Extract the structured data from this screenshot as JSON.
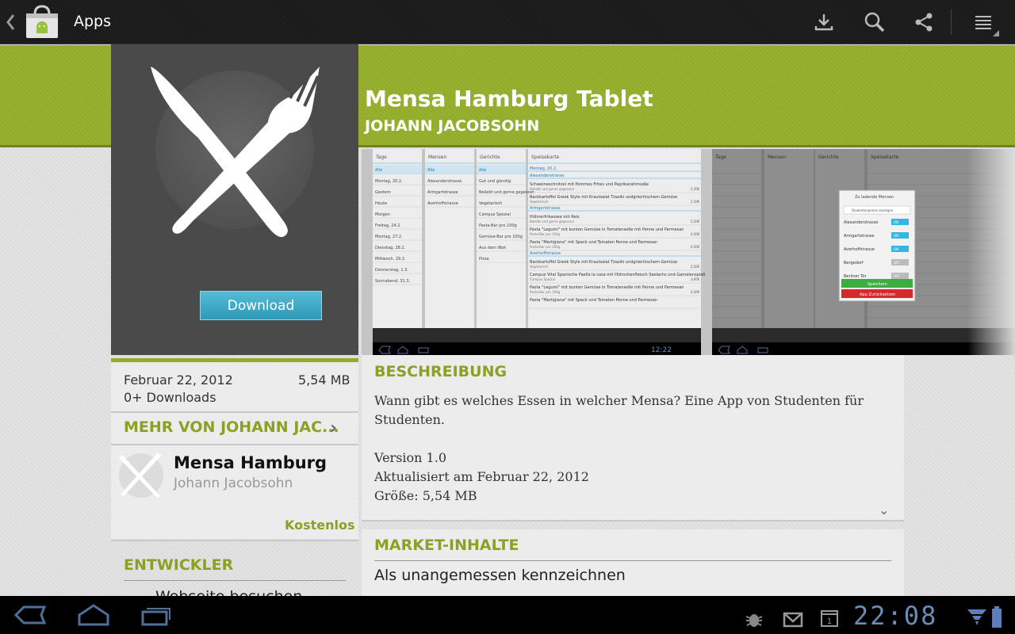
{
  "action_bar": {
    "title": "Apps",
    "icons": [
      "up-chevron-icon",
      "market-bag-icon",
      "download-icon",
      "search-icon",
      "share-icon",
      "overflow-menu-icon"
    ]
  },
  "app": {
    "title": "Mensa Hamburg Tablet",
    "developer": "JOHANN JACOBSOHN",
    "download_label": "Download",
    "icon": "cutlery-icon"
  },
  "meta": {
    "date": "Februar 22, 2012",
    "size": "5,54 MB",
    "downloads": "0+ Downloads"
  },
  "more_from": {
    "heading": "MEHR VON JOHANN JAC...",
    "item": {
      "title": "Mensa Hamburg",
      "developer": "Johann Jacobsohn",
      "price": "Kostenlos"
    }
  },
  "developer_section": {
    "heading": "ENTWICKLER",
    "website_label": "Webseite besuchen"
  },
  "description": {
    "heading": "BESCHREIBUNG",
    "lines": [
      "Wann gibt es welches Essen in welcher Mensa? Eine App von Studenten für",
      "Studenten.",
      "",
      "Version 1.0",
      "Aktualisiert am Februar 22, 2012",
      "Größe: 5,54 MB"
    ]
  },
  "market": {
    "heading": "MARKET-INHALTE",
    "report_label": "Als unangemessen kennzeichnen"
  },
  "screenshot1": {
    "col_headers": [
      "Tage",
      "Mensen",
      "Gerichte",
      "Speisekarte"
    ],
    "days": [
      "Alle",
      "Montag, 20.2.",
      "Gestern",
      "Heute",
      "Morgen",
      "Freitag, 24.2.",
      "Montag, 27.2.",
      "Dienstag, 28.2.",
      "Mittwoch, 29.2.",
      "Donnerstag, 1.3.",
      "Sonnabend, 31.3."
    ],
    "mensen": [
      "Alle",
      "Alexanderstrasse",
      "Armgartstrasse",
      "Averhoffstrasse"
    ],
    "gerichte": [
      "Alle",
      "Gut und günstig",
      "Beliebt und gerne gegessen",
      "Vegetarisch",
      "Campus Spezial",
      "Pasta-Bar pro 100g",
      "Gemüse-Bar pro 100g",
      "Aus dem Wok",
      "Pizza"
    ],
    "menu": [
      {
        "type": "header",
        "text": "Montag, 20.2."
      },
      {
        "type": "header",
        "text": "Alexanderstrasse"
      },
      {
        "type": "item",
        "text": "Schweineschnitzel mit Pommes Frites und Paprikarahmsoße",
        "sub": "Beliebt und gerne gegessen",
        "price": "2,20€"
      },
      {
        "type": "item",
        "text": "Backkartoffel Greek Style mit Krautsalat Tzaziki undgriechischem Gemüse",
        "sub": "Vegetarisch",
        "price": "2,50€"
      },
      {
        "type": "header",
        "text": "Armgartstrasse"
      },
      {
        "type": "item",
        "text": "Hühnerfrikassee mit Reis",
        "sub": "Beliebt und gerne gegessen",
        "price": "2,50€"
      },
      {
        "type": "item",
        "text": "Pasta \"Legumi\" mit bunten Gemüse in Tomatensoße mit Penne und Parmesan",
        "sub": "Pasta-Bar pro 100g",
        "price": "0,50€"
      },
      {
        "type": "item",
        "text": "Pasta \"Martigiana\" mit Speck und Tomaten Penne und Parmesan",
        "sub": "Pasta-Bar pro 100g",
        "price": "0,50€"
      },
      {
        "type": "header",
        "text": "Averhoffstrasse"
      },
      {
        "type": "item",
        "text": "Backkartoffel Greek Style mit Krautsalat Tzaziki undgriechischem Gemüse",
        "sub": "Vegetarisch",
        "price": "2,50€"
      },
      {
        "type": "item",
        "text": "Campus Vital Spanische Paella la casa mit Hühnchenfleisch Seelachs und Garnelenspieß",
        "sub": "Campus Spezial",
        "price": "3,95€"
      },
      {
        "type": "item",
        "text": "Pasta \"Legumi\" mit bunten Gemüse in Tomatensoße mit Penne und Parmesan",
        "sub": "Pasta-Bar pro 100g",
        "price": "0,50€"
      },
      {
        "type": "item",
        "text": "Pasta \"Martigiana\" mit Speck und Tomaten Penne und Parmesan",
        "sub": "",
        "price": ""
      }
    ],
    "clock": "12:22"
  },
  "screenshot2": {
    "col_headers": [
      "Tage",
      "Mensen",
      "Gerichte",
      "Speisekarte"
    ],
    "dialog": {
      "title": "Zu ladende Mensen",
      "field": "Studentenpreise anzeigen",
      "toggles": [
        {
          "label": "Alexanderstrasse",
          "state": "ON"
        },
        {
          "label": "Armgartstrasse",
          "state": "ON"
        },
        {
          "label": "Averhoffstrasse",
          "state": "ON"
        },
        {
          "label": "Bergedorf",
          "state": "OFF"
        },
        {
          "label": "Berliner Tor",
          "state": "OFF"
        }
      ],
      "save_label": "Speichern",
      "reset_label": "App Zurücksetzen"
    }
  },
  "system_bar": {
    "clock": "22:08",
    "icons": [
      "back-icon",
      "home-icon",
      "recent-apps-icon",
      "debug-icon",
      "gmail-icon",
      "calendar-icon",
      "wifi-icon",
      "battery-icon"
    ],
    "calendar_day": "1"
  },
  "colors": {
    "accent_green": "#93ac2a",
    "section_green": "#8ba123",
    "download_blue": "#2d9ab8",
    "clock_blue": "#6d8bb5"
  }
}
